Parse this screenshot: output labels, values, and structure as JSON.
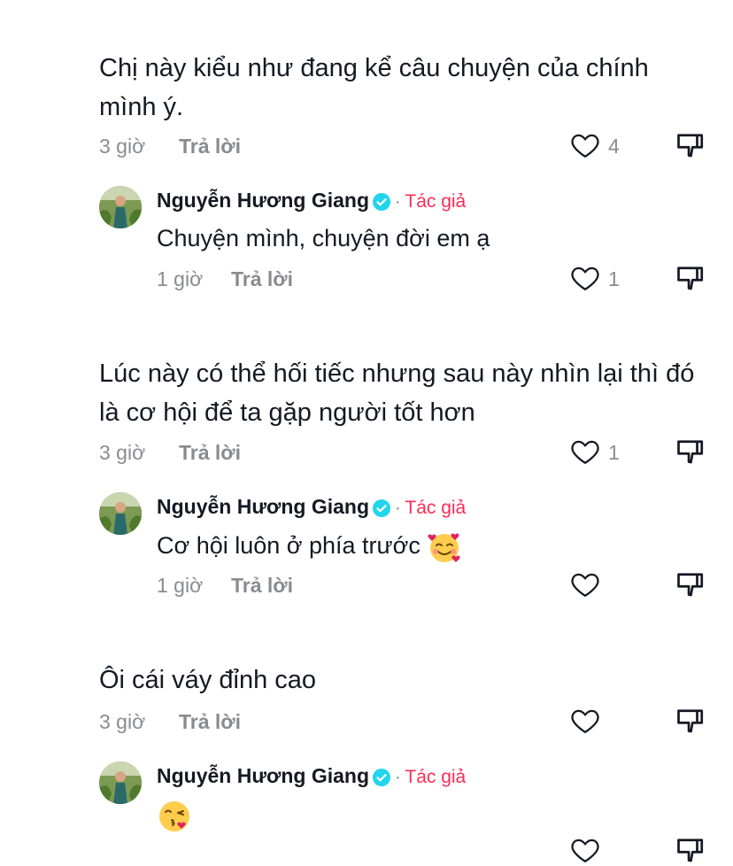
{
  "comments": [
    {
      "text": "Chị này kiểu như đang kể câu chuyện của chính mình ý.",
      "time": "3 giờ",
      "reply_label": "Trả lời",
      "likes": "4",
      "reply": {
        "author": "Nguyễn Hương Giang",
        "author_badge": "Tác giả",
        "separator": "·",
        "text": "Chuyện mình, chuyện đời em ạ",
        "time": "1 giờ",
        "reply_label": "Trả lời",
        "likes": "1"
      }
    },
    {
      "text": "Lúc này có thể hối tiếc nhưng sau này nhìn lại thì đó là cơ hội để ta gặp người tốt hơn",
      "time": "3 giờ",
      "reply_label": "Trả lời",
      "likes": "1",
      "reply": {
        "author": "Nguyễn Hương Giang",
        "author_badge": "Tác giả",
        "separator": "·",
        "text": "Cơ hội luôn ở phía trước",
        "emoji": "smiling-face-with-hearts",
        "time": "1 giờ",
        "reply_label": "Trả lời",
        "likes": ""
      }
    },
    {
      "text": "Ôi cái váy đỉnh cao",
      "time": "3 giờ",
      "reply_label": "Trả lời",
      "likes": "",
      "reply": {
        "author": "Nguyễn Hương Giang",
        "author_badge": "Tác giả",
        "separator": "·",
        "text": "",
        "emoji": "face-blowing-kiss"
      }
    }
  ],
  "colors": {
    "text": "#161823",
    "muted": "#8a8b91",
    "author_badge": "#fe2c55",
    "verified": "#20d5ec",
    "icon": "#161823"
  }
}
